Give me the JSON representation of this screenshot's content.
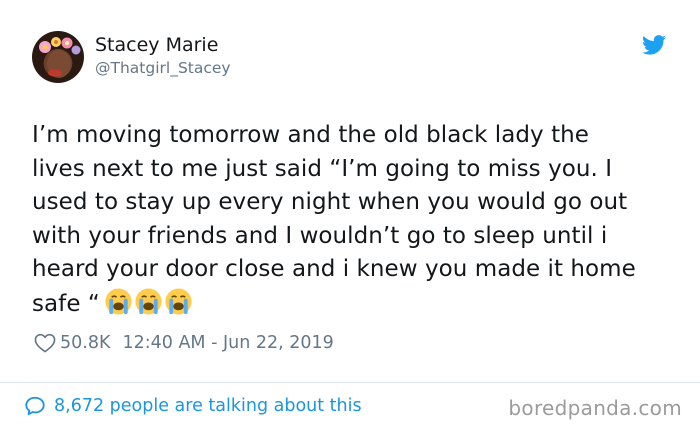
{
  "tweet": {
    "author_name": "Stacey Marie",
    "author_handle": "@Thatgirl_Stacey",
    "text_lines": [
      "I’m moving tomorrow and the old black lady the",
      "lives next to me just said “I’m going to miss you. I",
      "used to stay up every night when you would go out",
      "with your friends and I wouldn’t go to sleep until i",
      "heard your door close and i knew you made it home",
      "safe “"
    ],
    "emojis": [
      "loudly-crying-face-emoji",
      "loudly-crying-face-emoji",
      "loudly-crying-face-emoji"
    ],
    "likes": "50.8K",
    "timestamp": "12:40 AM - Jun 22, 2019",
    "talking": "8,672 people are talking about this"
  },
  "icons": {
    "platform": "twitter-bird-icon",
    "like": "heart-outline-icon",
    "reply": "speech-bubble-icon"
  },
  "colors": {
    "twitter_blue": "#1da1f2",
    "link_blue": "#1b95e0",
    "secondary_text": "#657786",
    "primary_text": "#14171a",
    "watermark": "#9b9b9b"
  },
  "watermark": "boredpanda.com"
}
